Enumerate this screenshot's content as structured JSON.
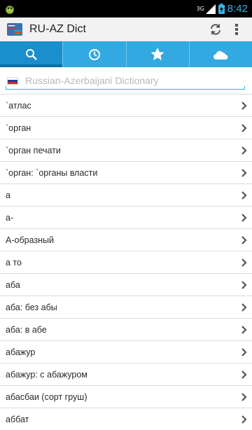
{
  "status_bar": {
    "network": "3G",
    "time": "8:42"
  },
  "action_bar": {
    "title": "RU-AZ Dict",
    "refresh_icon": "refresh-icon",
    "overflow_icon": "overflow-menu-icon"
  },
  "tabs": [
    {
      "icon": "search-icon",
      "active": true
    },
    {
      "icon": "clock-icon",
      "active": false
    },
    {
      "icon": "star-icon",
      "active": false
    },
    {
      "icon": "cloud-icon",
      "active": false
    }
  ],
  "search": {
    "placeholder": "Russian-Azerbaijani Dictionary",
    "value": ""
  },
  "colors": {
    "accent": "#33b5e5",
    "tab_bar": "#32a9e0",
    "tab_active": "#1a8fcc"
  },
  "words": [
    {
      "label": "`атлас"
    },
    {
      "label": "`орган"
    },
    {
      "label": "`орган печати"
    },
    {
      "label": "`орган: `органы власти"
    },
    {
      "label": "а"
    },
    {
      "label": "а-"
    },
    {
      "label": "А-образный"
    },
    {
      "label": "а то"
    },
    {
      "label": "аба"
    },
    {
      "label": "аба: без абы"
    },
    {
      "label": "аба: в абе"
    },
    {
      "label": "абажур"
    },
    {
      "label": "абажур: с абажуром"
    },
    {
      "label": "абасбаи (сорт груш)"
    },
    {
      "label": "аббат"
    }
  ]
}
